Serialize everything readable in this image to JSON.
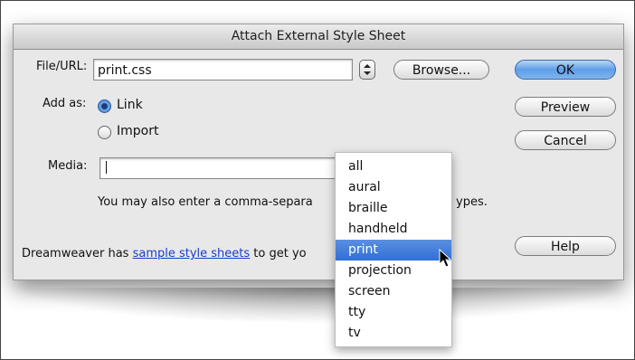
{
  "dialog": {
    "title": "Attach External Style Sheet"
  },
  "form": {
    "file_label": "File/URL:",
    "file_value": "print.css",
    "browse_label": "Browse...",
    "add_as_label": "Add as:",
    "radio_link": "Link",
    "radio_import": "Import",
    "selected_add_as": "Link",
    "media_label": "Media:",
    "media_value": "",
    "help_media_text": "You may also enter a comma-separa",
    "help_media_tail": "ypes.",
    "footer_prefix": "Dreamweaver has ",
    "footer_link": "sample style sheets",
    "footer_suffix": " to get yo"
  },
  "buttons": {
    "ok": "OK",
    "preview": "Preview",
    "cancel": "Cancel",
    "help": "Help"
  },
  "dropdown": {
    "options": [
      "all",
      "aural",
      "braille",
      "handheld",
      "print",
      "projection",
      "screen",
      "tty",
      "tv"
    ],
    "selected": "print"
  },
  "colors": {
    "accent": "#2f6fd6",
    "link": "#1a3dcc"
  },
  "icons": {
    "stepper": "up-down-stepper-icon",
    "cursor": "arrow-cursor-icon"
  }
}
